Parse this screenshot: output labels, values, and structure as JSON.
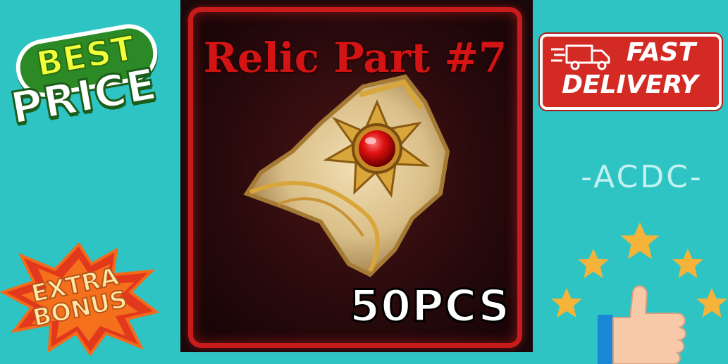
{
  "badges": {
    "best": "BEST",
    "price": "PRICE",
    "extra_bonus_line1": "EXTRA",
    "extra_bonus_line2": "BONUS",
    "fast": "FAST",
    "delivery": "DELIVERY"
  },
  "product": {
    "title": "Relic Part #7",
    "quantity": "50PCS"
  },
  "seller": {
    "tag": "-ACDC-"
  },
  "rating": {
    "stars": 5
  },
  "colors": {
    "background": "#2ec4c4",
    "card_border": "#c81c1c",
    "title_red": "#d41414",
    "best_green": "#2c8a26",
    "best_yellow": "#f0ff3a",
    "delivery_red": "#d42a24",
    "star_gold": "#f6b33a",
    "burst_red": "#e2381c"
  },
  "icons": [
    "truck-icon",
    "star-icon",
    "thumbs-up-icon",
    "relic-gem-icon"
  ]
}
